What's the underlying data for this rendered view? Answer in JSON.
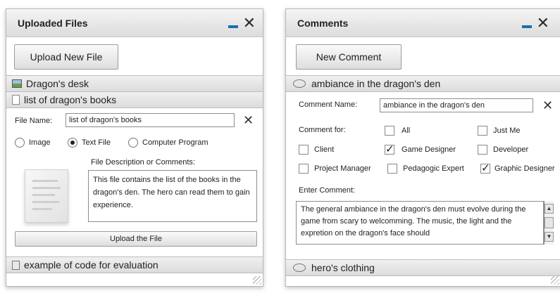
{
  "left": {
    "title": "Uploaded Files",
    "upload_button": "Upload New File",
    "files": [
      {
        "label": "Dragon's desk",
        "icon": "image-file-icon"
      },
      {
        "label": "list of dragon's books",
        "icon": "text-file-icon"
      },
      {
        "label": "example of code for evaluation",
        "icon": "code-file-icon"
      }
    ],
    "form": {
      "file_name_label": "File Name:",
      "file_name_value": "list of dragon's books",
      "types": [
        {
          "label": "Image",
          "checked": false
        },
        {
          "label": "Text File",
          "checked": true
        },
        {
          "label": "Computer Program",
          "checked": false
        }
      ],
      "description_label": "File Description or Comments:",
      "description_text": "This file contains the list of the books in the dragon's den. The hero can read them to gain experience.",
      "upload_file_button": "Upload the File"
    }
  },
  "right": {
    "title": "Comments",
    "new_comment_button": "New Comment",
    "comments": [
      {
        "label": "ambiance in the dragon's den"
      },
      {
        "label": "hero's clothing"
      }
    ],
    "form": {
      "name_label": "Comment Name:",
      "name_value": "ambiance in the dragon's den",
      "comment_for_label": "Comment for:",
      "options": [
        {
          "label": "All",
          "checked": false
        },
        {
          "label": "Just Me",
          "checked": false
        },
        {
          "label": "Client",
          "checked": false
        },
        {
          "label": "Game Designer",
          "checked": true
        },
        {
          "label": "Developer",
          "checked": false
        },
        {
          "label": "Project Manager",
          "checked": false
        },
        {
          "label": "Pedagogic Expert",
          "checked": false
        },
        {
          "label": "Graphic Designer",
          "checked": true
        }
      ],
      "enter_comment_label": "Enter Comment:",
      "comment_text": "The general ambiance in the dragon's den must evolve during the game from scary to welcomming. The music, the light and the expretion on the dragon's face should"
    }
  },
  "colors": {
    "minimize": "#1c6fa8",
    "titlebar": "#e6e6e6",
    "border": "#b9b9b9"
  }
}
